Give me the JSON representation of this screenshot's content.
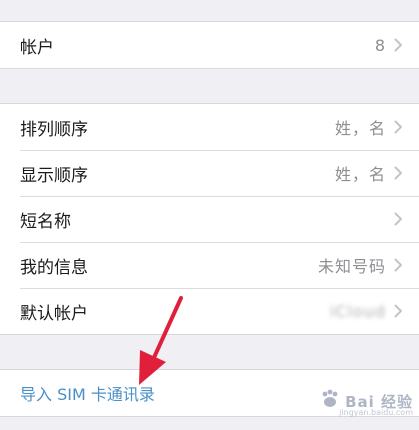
{
  "accounts_section": {
    "accounts": {
      "label": "帐户",
      "value": "8"
    }
  },
  "contacts_section": {
    "sort_order": {
      "label": "排列顺序",
      "value": "姓，名"
    },
    "display_order": {
      "label": "显示顺序",
      "value": "姓，名"
    },
    "short_name": {
      "label": "短名称",
      "value": ""
    },
    "my_info": {
      "label": "我的信息",
      "value": "未知号码"
    },
    "default_account": {
      "label": "默认帐户",
      "value": "iCloud"
    }
  },
  "import_section": {
    "import_sim": {
      "label": "导入 SIM 卡通讯录"
    }
  },
  "watermark": {
    "text": "Bai 经验",
    "url": "jingyan.baidu.com"
  },
  "colors": {
    "background": "#efeff4",
    "link": "#4a90c8",
    "annotation_arrow": "#e0203a"
  }
}
